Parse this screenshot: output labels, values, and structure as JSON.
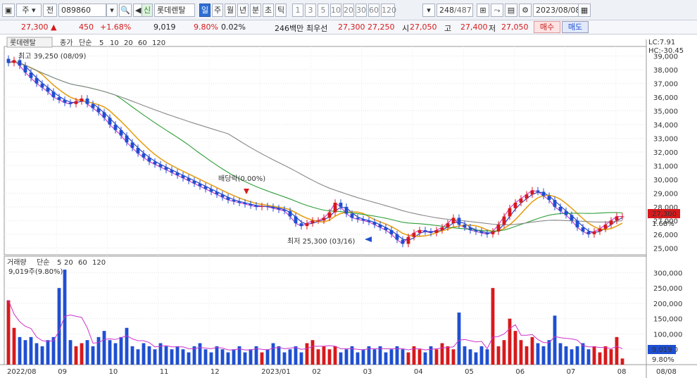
{
  "toolbar": {
    "mode_label": "주",
    "prev_label": "전",
    "code": "089860",
    "sin_label": "신",
    "stock_name": "롯데렌탈",
    "periods": [
      "일",
      "주",
      "월",
      "년",
      "분",
      "초",
      "틱"
    ],
    "selected_period": "일",
    "minute_steps": [
      "1",
      "3",
      "5",
      "10",
      "20",
      "30",
      "60",
      "120"
    ],
    "count": "248",
    "total": "/487",
    "date": "2023/08/08"
  },
  "quote": {
    "price": "27,300",
    "change_arrow": "▲",
    "change": "450",
    "change_pct": "+1.68%",
    "volume": "9,019",
    "volume_pct": "9.80%",
    "turnover_pct": "0.02%",
    "amount": "246백만",
    "best_label": "최우선",
    "best_ask": "27,300",
    "best_bid": "27,250",
    "open_label": "시",
    "open": "27,050",
    "high_label": "고",
    "high": "27,400",
    "low_label": "저",
    "low": "27,050",
    "buy_label": "매수",
    "sell_label": "매도"
  },
  "legend_price": {
    "name": "롯데렌탈",
    "close_label": "종가",
    "ma_type": "단순",
    "periods": [
      "5",
      "10",
      "20",
      "60",
      "120"
    ],
    "colors": [
      "#cc33cc",
      "#2233bb",
      "#e6a01a",
      "#2e9e3a",
      "#888888"
    ]
  },
  "legend_volume": {
    "name": "거래량",
    "ma_type": "단순",
    "periods": [
      "5",
      "20",
      "60",
      "120"
    ],
    "current": "9,019주(9.80%)"
  },
  "annotations": {
    "high": "최고 39,250 (08/09)",
    "low": "최저 25,300 (03/16)",
    "dividend": "배당락(0.00%)"
  },
  "right_panel": {
    "lc": "LC:7.91",
    "hc": "HC:-30.45",
    "price_tag": "27,300",
    "pct_tag": "1.68%",
    "vol_tag": "9,019",
    "vol_pct_tag": "9.80%"
  },
  "price_axis": [
    "39,000",
    "38,000",
    "37,000",
    "36,000",
    "35,000",
    "34,000",
    "33,000",
    "32,000",
    "31,000",
    "30,000",
    "29,000",
    "28,000",
    "27,000",
    "26,000",
    "25,000"
  ],
  "volume_axis": [
    "300,000",
    "250,000",
    "200,000",
    "150,000",
    "100,000",
    "50,000"
  ],
  "date_axis": [
    "2022/08",
    "09",
    "10",
    "11",
    "12",
    "2023/01",
    "02",
    "03",
    "04",
    "05",
    "06",
    "07",
    "08"
  ],
  "date_tag": "08/08",
  "chart_data": {
    "type": "candlestick",
    "price_range": [
      24500,
      39700
    ],
    "volume_range": [
      0,
      340000
    ],
    "close_series_approx": [
      38500,
      38700,
      38300,
      37800,
      37400,
      37000,
      36700,
      36400,
      36000,
      35800,
      35600,
      35500,
      35700,
      35900,
      35500,
      35200,
      34900,
      34500,
      34000,
      33600,
      33200,
      32700,
      32300,
      31900,
      31600,
      31300,
      31100,
      30900,
      30700,
      30500,
      30300,
      30100,
      29900,
      29700,
      29500,
      29300,
      29100,
      28900,
      28700,
      28500,
      28400,
      28300,
      28200,
      28100,
      28000,
      28050,
      28000,
      27900,
      27800,
      27700,
      27300,
      26800,
      26600,
      26800,
      27000,
      27000,
      27200,
      27600,
      28300,
      28000,
      27500,
      27200,
      27100,
      27000,
      26900,
      26700,
      26500,
      26300,
      26000,
      25600,
      25300,
      25800,
      26100,
      26300,
      26200,
      26100,
      26300,
      26500,
      26800,
      27200,
      26700,
      26500,
      26300,
      26200,
      26100,
      26000,
      26200,
      26700,
      27300,
      27900,
      28300,
      28600,
      28900,
      29200,
      29100,
      28800,
      28500,
      28000,
      27700,
      27400,
      27000,
      26500,
      26200,
      26000,
      26200,
      26400,
      26700,
      27000,
      27300,
      27300
    ],
    "volume_series_approx": [
      210000,
      120000,
      90000,
      80000,
      90000,
      70000,
      60000,
      80000,
      90000,
      250000,
      310000,
      80000,
      60000,
      70000,
      80000,
      60000,
      90000,
      110000,
      80000,
      70000,
      90000,
      120000,
      60000,
      50000,
      70000,
      60000,
      50000,
      70000,
      60000,
      50000,
      60000,
      50000,
      40000,
      60000,
      70000,
      50000,
      40000,
      60000,
      50000,
      40000,
      50000,
      60000,
      40000,
      50000,
      60000,
      40000,
      50000,
      70000,
      60000,
      40000,
      50000,
      60000,
      40000,
      70000,
      80000,
      50000,
      60000,
      50000,
      60000,
      40000,
      50000,
      60000,
      40000,
      50000,
      60000,
      50000,
      60000,
      40000,
      50000,
      60000,
      50000,
      40000,
      60000,
      50000,
      40000,
      60000,
      50000,
      70000,
      60000,
      50000,
      170000,
      60000,
      50000,
      40000,
      60000,
      50000,
      250000,
      60000,
      80000,
      150000,
      110000,
      80000,
      60000,
      90000,
      70000,
      60000,
      80000,
      160000,
      70000,
      60000,
      50000,
      60000,
      70000,
      50000,
      60000,
      40000,
      60000,
      50000,
      90000,
      20000
    ]
  }
}
